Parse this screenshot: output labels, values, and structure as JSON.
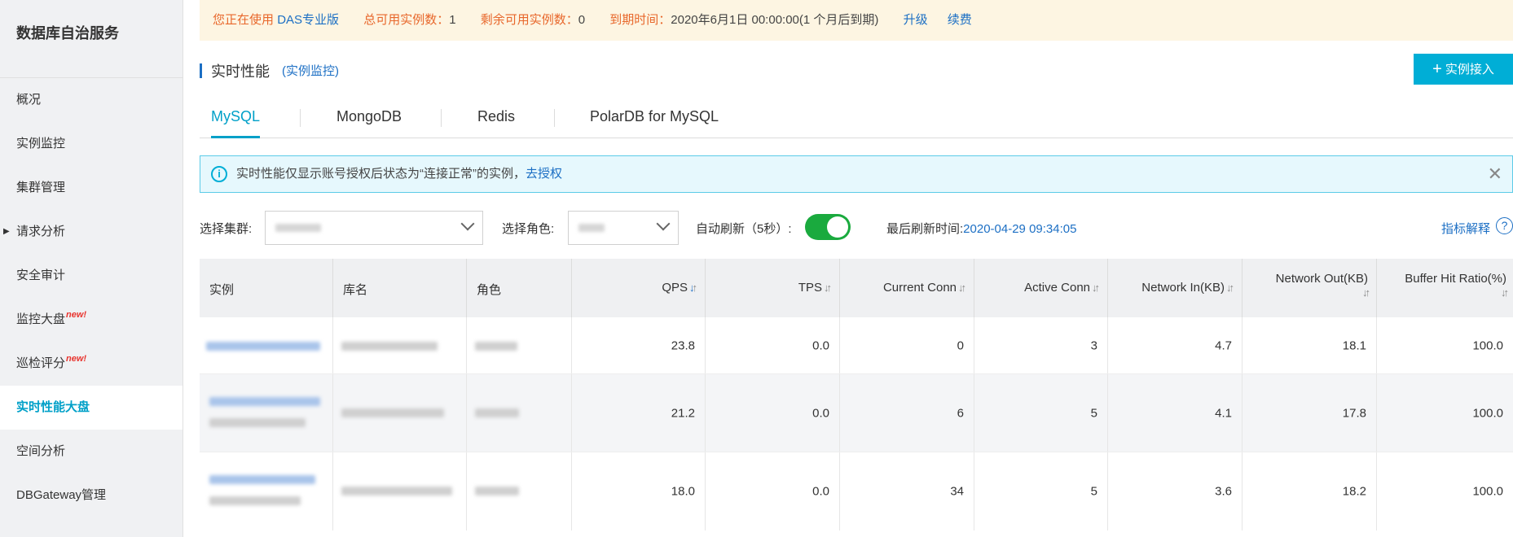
{
  "sidebar": {
    "brand": "数据库自治服务",
    "items": [
      {
        "label": "概况"
      },
      {
        "label": "实例监控"
      },
      {
        "label": "集群管理"
      },
      {
        "label": "请求分析"
      },
      {
        "label": "安全审计"
      },
      {
        "label": "监控大盘",
        "badge": "new!"
      },
      {
        "label": "巡检评分",
        "badge": "new!"
      },
      {
        "label": "实时性能大盘"
      },
      {
        "label": "空间分析"
      },
      {
        "label": "DBGateway管理"
      }
    ],
    "active_index": 7
  },
  "banner": {
    "using_prefix": "您正在使用",
    "edition": "DAS专业版",
    "total_label": "总可用实例数：",
    "total_value": "1",
    "remain_label": "剩余可用实例数：",
    "remain_value": "0",
    "expire_label": "到期时间：",
    "expire_value": "2020年6月1日 00:00:00(1 个月后到期)",
    "upgrade": "升级",
    "renew": "续费"
  },
  "header": {
    "title": "实时性能",
    "subtitle": "(实例监控)",
    "add_button": "实例接入"
  },
  "tabs": [
    "MySQL",
    "MongoDB",
    "Redis",
    "PolarDB for MySQL"
  ],
  "notice": {
    "text": "实时性能仅显示账号授权后状态为“连接正常”的实例，",
    "link": "去授权"
  },
  "filters": {
    "cluster_label": "选择集群:",
    "role_label": "选择角色:",
    "auto_refresh_label": "自动刷新（5秒）:",
    "auto_refresh_on": true,
    "last_refresh_label": "最后刷新时间:",
    "last_refresh_time": "2020-04-29 09:34:05",
    "metric_help": "指标解释"
  },
  "table": {
    "columns": [
      "实例",
      "库名",
      "角色",
      "QPS",
      "TPS",
      "Current Conn",
      "Active Conn",
      "Network In(KB)",
      "Network Out(KB)",
      "Buffer Hit Ratio(%)"
    ],
    "rows": [
      {
        "qps": "23.8",
        "tps": "0.0",
        "current_conn": "0",
        "active_conn": "3",
        "net_in": "4.7",
        "net_out": "18.1",
        "buffer_hit": "100.0"
      },
      {
        "qps": "21.2",
        "tps": "0.0",
        "current_conn": "6",
        "active_conn": "5",
        "net_in": "4.1",
        "net_out": "17.8",
        "buffer_hit": "100.0"
      },
      {
        "qps": "18.0",
        "tps": "0.0",
        "current_conn": "34",
        "active_conn": "5",
        "net_in": "3.6",
        "net_out": "18.2",
        "buffer_hit": "100.0"
      }
    ]
  },
  "colors": {
    "accent": "#00a0c8",
    "link": "#1c6fc4",
    "warning": "#e8672b",
    "toggle_on": "#1aaa3e"
  }
}
